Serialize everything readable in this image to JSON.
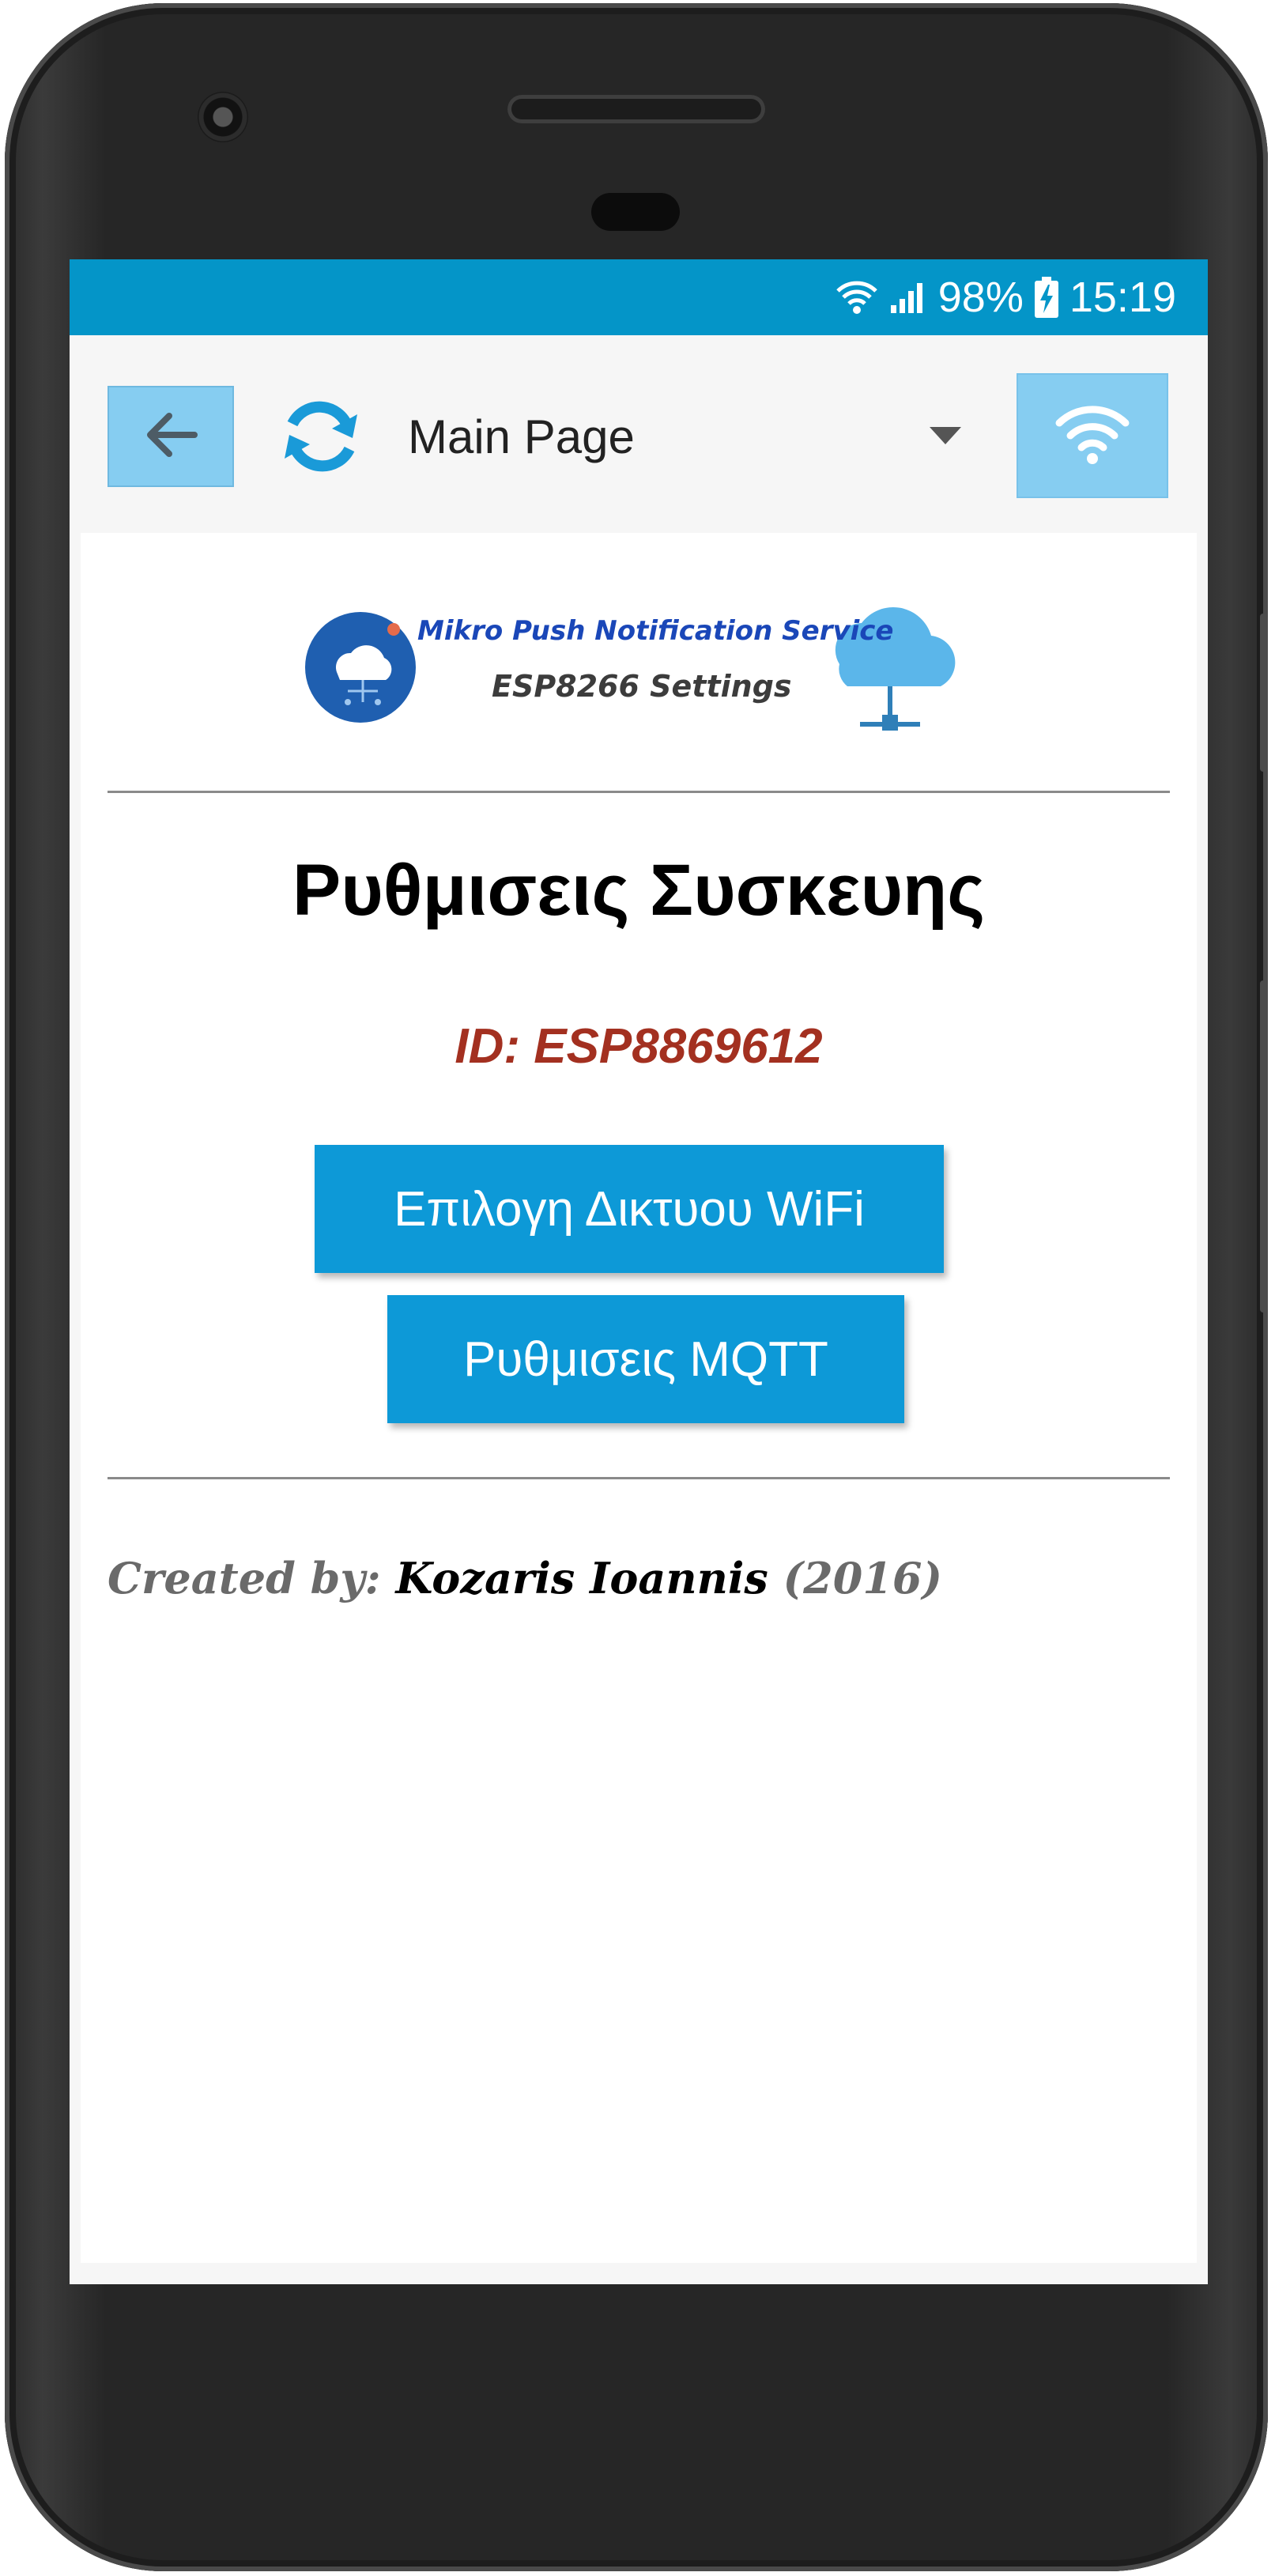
{
  "status_bar": {
    "battery": "98%",
    "time": "15:19",
    "icons": [
      "wifi-icon",
      "cell-signal-icon",
      "battery-charging-icon"
    ]
  },
  "toolbar": {
    "back_icon": "arrow-left-icon",
    "refresh_icon": "refresh-icon",
    "page_select_value": "Main Page",
    "wifi_icon": "wifi-icon"
  },
  "logo": {
    "line1": "Mikro Push Notification Service",
    "line2": "ESP8266 Settings"
  },
  "main": {
    "title": "Ρυθμισεις Συσκευης",
    "device_id": "ID: ESP8869612",
    "wifi_button_label": "Επιλογη Δικτυου WiFi",
    "mqtt_button_label": "Ρυθμισεις MQTT"
  },
  "footer": {
    "created_by_label": "Created by:",
    "author": "Kozaris Ioannis",
    "year": "(2016)"
  },
  "colors": {
    "status_bar": "#0495c8",
    "button": "#0d99d7",
    "toolbar_button": "#86cdf1",
    "id_text": "#a33020",
    "refresh_icon": "#1a9ad8"
  }
}
